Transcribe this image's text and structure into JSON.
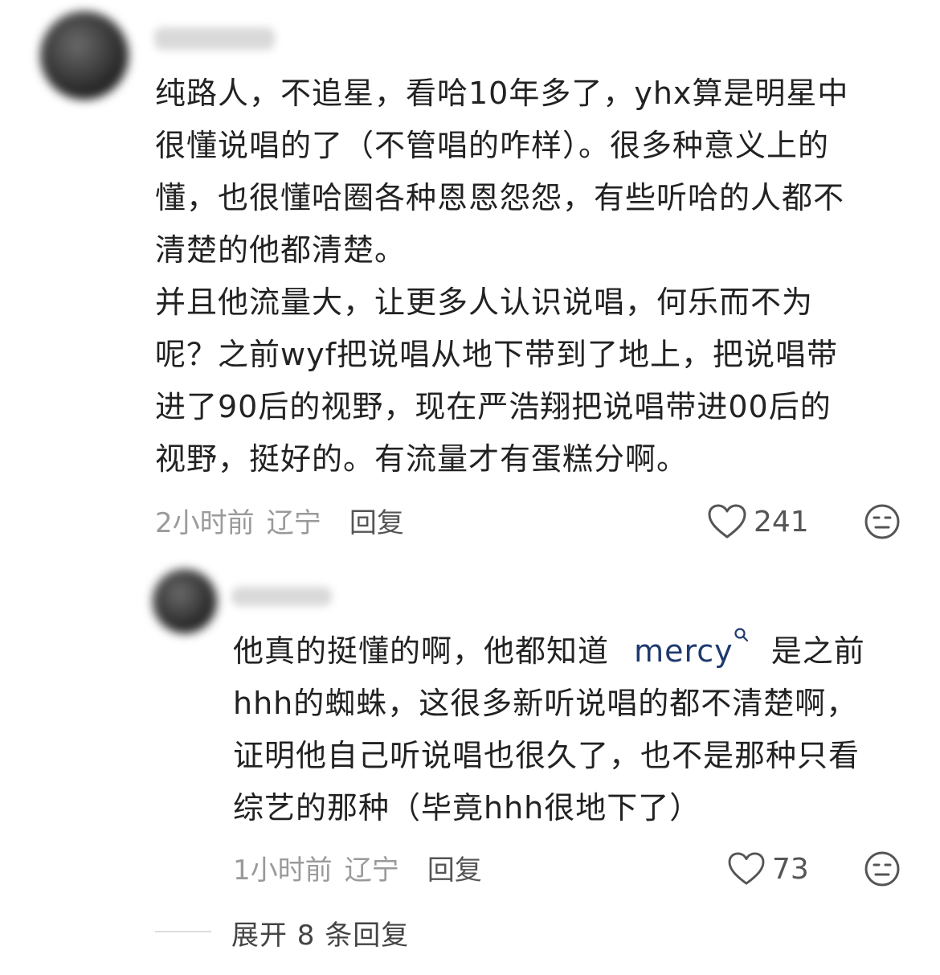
{
  "comment": {
    "lines": [
      "纯路人，不追星，看哈10年多了，yhx算是明星中",
      "很懂说唱的了（不管唱的咋样）。很多种意义上的",
      "懂，也很懂哈圈各种恩恩怨怨，有些听哈的人都不",
      "清楚的他都清楚。",
      "并且他流量大，让更多人认识说唱，何乐而不为",
      "呢？之前wyf把说唱从地下带到了地上，把说唱带",
      "进了90后的视野，现在严浩翔把说唱带进00后的",
      "视野，挺好的。有流量才有蛋糕分啊。"
    ],
    "time": "2小时前",
    "location": "辽宁",
    "reply_label": "回复",
    "likes": "241"
  },
  "reply": {
    "line1_pre": "他真的挺懂的啊，他都知道",
    "mention": "mercy",
    "line1_post": "是之前",
    "lines": [
      "hhh的蜘蛛，这很多新听说唱的都不清楚啊，",
      "证明他自己听说唱也很久了，也不是那种只看",
      "综艺的那种（毕竟hhh很地下了）"
    ],
    "time": "1小时前",
    "location": "辽宁",
    "reply_label": "回复",
    "likes": "73"
  },
  "expand_label": "展开 8 条回复",
  "icons": {
    "like": "heart-outline-icon",
    "emoji": "meh-face-icon",
    "mention_search": "search-icon"
  },
  "colors": {
    "text": "#222222",
    "meta": "#9a9a9a",
    "mention": "#1e3a6e"
  }
}
